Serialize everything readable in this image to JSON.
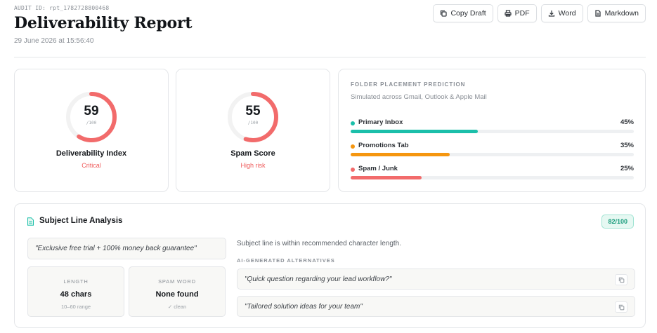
{
  "header": {
    "audit_id": "AUDIT ID: rpt_1782728800468",
    "title": "Deliverability Report",
    "date": "29 June 2026 at 15:56:40"
  },
  "toolbar": {
    "copy_draft": "Copy Draft",
    "pdf": "PDF",
    "word": "Word",
    "markdown": "Markdown"
  },
  "scores": [
    {
      "value": "59",
      "value_num": 59,
      "max": "/100",
      "label": "Deliverability Index",
      "status": "Critical",
      "color": "#f26b6b"
    },
    {
      "value": "55",
      "value_num": 55,
      "max": "/100",
      "label": "Spam Score",
      "status": "High risk",
      "color": "#f26b6b"
    }
  ],
  "folder_placement": {
    "title": "FOLDER PLACEMENT PREDICTION",
    "subtitle": "Simulated across Gmail, Outlook & Apple Mail",
    "rows": [
      {
        "label": "Primary Inbox",
        "value": "45%",
        "percent": 45,
        "color": "#1bbfaa"
      },
      {
        "label": "Promotions Tab",
        "value": "35%",
        "percent": 35,
        "color": "#f5960f"
      },
      {
        "label": "Spam / Junk",
        "value": "25%",
        "percent": 25,
        "color": "#f26b6b"
      }
    ]
  },
  "subject_analysis": {
    "title": "Subject Line Analysis",
    "score_badge": "82/100",
    "subject": "\"Exclusive free trial + 100% money back guarantee\"",
    "length_label": "LENGTH",
    "length_value": "48 chars",
    "length_hint": "10–60 range",
    "spam_word_label": "SPAM WORD",
    "spam_word_value": "None found",
    "spam_word_hint": "✓ clean",
    "note": "Subject line is within recommended character length.",
    "alternatives_title": "AI-GENERATED ALTERNATIVES",
    "alternatives": [
      "\"Quick question regarding your lead workflow?\"",
      "\"Tailored solution ideas for your team\""
    ]
  }
}
